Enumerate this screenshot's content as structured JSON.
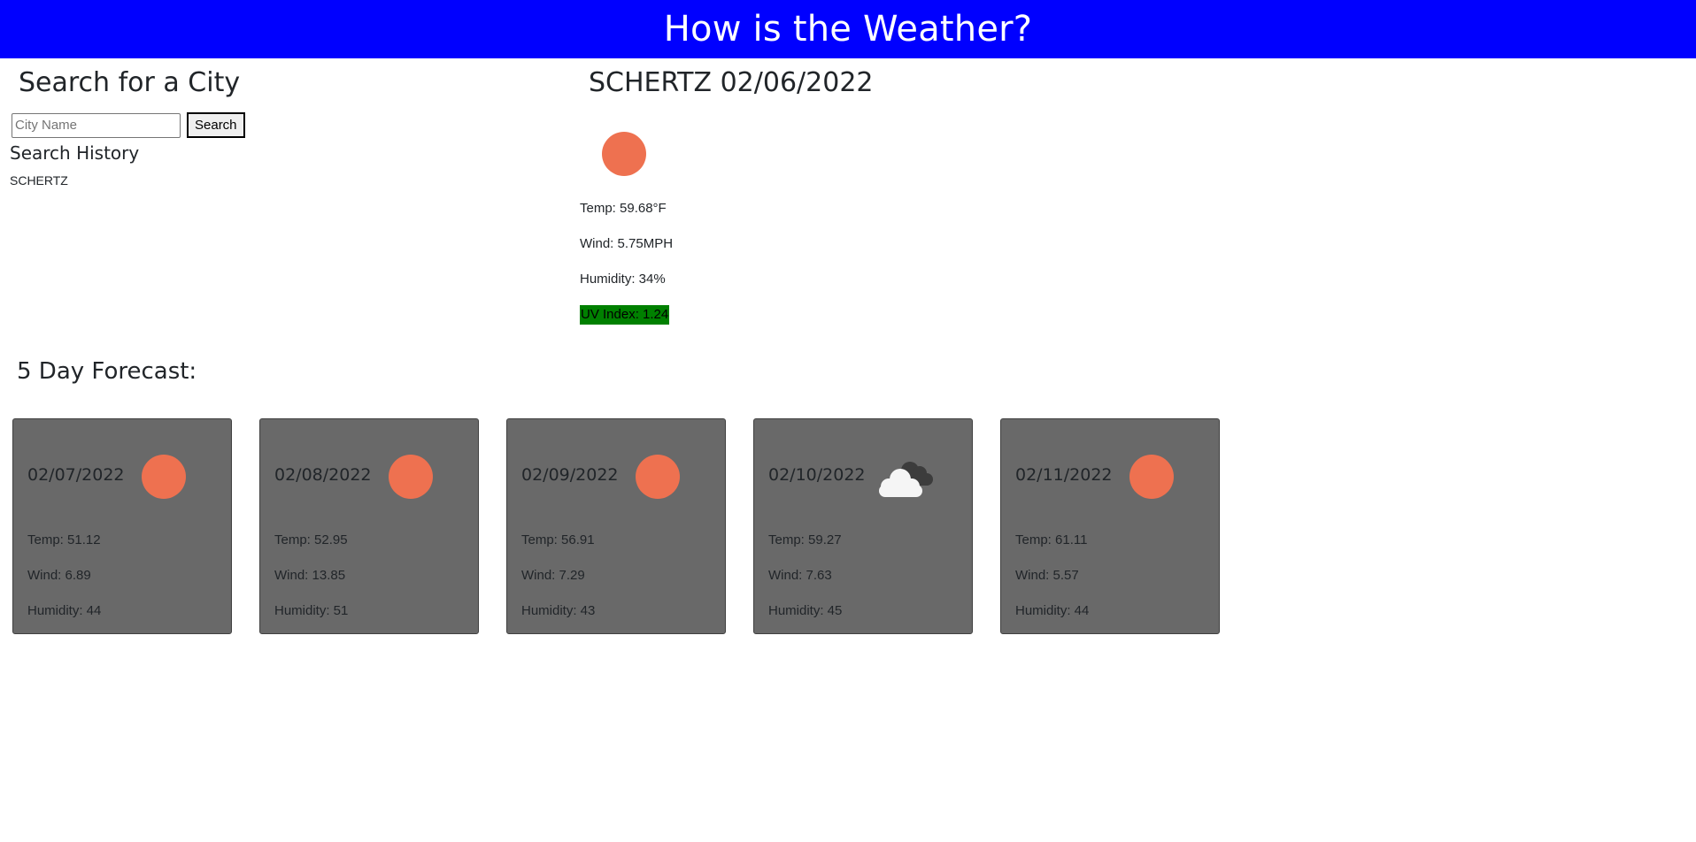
{
  "header": {
    "title": "How is the Weather?"
  },
  "search": {
    "title": "Search for a City",
    "placeholder": "City Name",
    "button_label": "Search",
    "history_title": "Search History",
    "history": [
      "SCHERTZ"
    ]
  },
  "current": {
    "title": "SCHERTZ 02/06/2022",
    "icon": "sun-icon",
    "temp": "Temp: 59.68°F",
    "wind": "Wind: 5.75MPH",
    "humidity": "Humidity: 34%",
    "uv": "UV Index: 1.24",
    "uv_color": "#008000"
  },
  "forecast": {
    "title": "5 Day Forecast:",
    "days": [
      {
        "date": "02/07/2022",
        "icon": "sun-icon",
        "temp": "Temp: 51.12",
        "wind": "Wind: 6.89",
        "humidity": "Humidity: 44"
      },
      {
        "date": "02/08/2022",
        "icon": "sun-icon",
        "temp": "Temp: 52.95",
        "wind": "Wind: 13.85",
        "humidity": "Humidity: 51"
      },
      {
        "date": "02/09/2022",
        "icon": "sun-icon",
        "temp": "Temp: 56.91",
        "wind": "Wind: 7.29",
        "humidity": "Humidity: 43"
      },
      {
        "date": "02/10/2022",
        "icon": "cloud-icon",
        "temp": "Temp: 59.27",
        "wind": "Wind: 7.63",
        "humidity": "Humidity: 45"
      },
      {
        "date": "02/11/2022",
        "icon": "sun-icon",
        "temp": "Temp: 61.11",
        "wind": "Wind: 5.57",
        "humidity": "Humidity: 44"
      }
    ]
  },
  "colors": {
    "header_bg": "#0000ff",
    "card_bg": "#696969",
    "sun": "#ee7150"
  }
}
